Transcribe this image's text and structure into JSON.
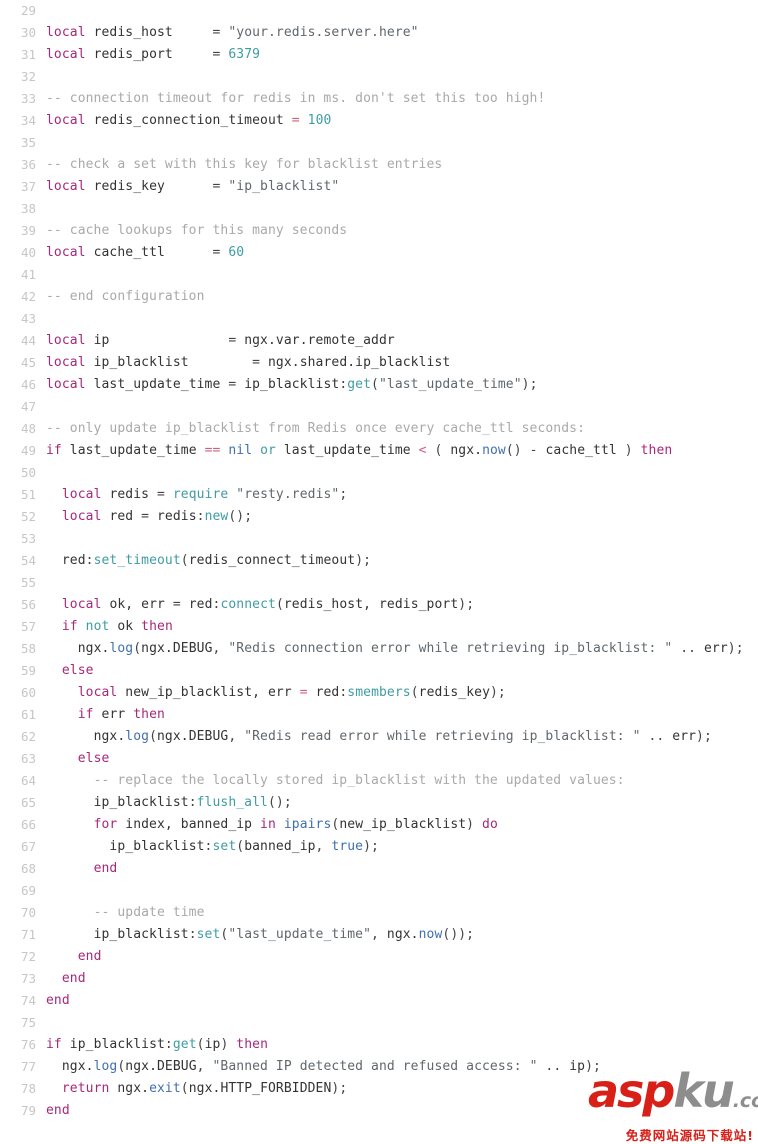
{
  "editor": {
    "language": "lua",
    "first_line_number": 29,
    "colors": {
      "background": "#ffffff",
      "gutter_text": "#c6c6c6",
      "default_text": "#333333",
      "keyword": "#a6287a",
      "number": "#3f9ca4",
      "string": "#60676d",
      "comment": "#a9a9a9",
      "function": "#3f9ca4",
      "builtin": "#4070b0",
      "operator": "#d0607a"
    }
  },
  "lines": [
    {
      "n": 29,
      "tokens": []
    },
    {
      "n": 30,
      "tokens": [
        {
          "t": "kw",
          "s": "local"
        },
        {
          "t": "pun",
          "s": " "
        },
        {
          "t": "id",
          "s": "redis_host"
        },
        {
          "t": "pun",
          "s": "     = "
        },
        {
          "t": "str",
          "s": "\"your.redis.server.here\""
        }
      ]
    },
    {
      "n": 31,
      "tokens": [
        {
          "t": "kw",
          "s": "local"
        },
        {
          "t": "pun",
          "s": " "
        },
        {
          "t": "id",
          "s": "redis_port"
        },
        {
          "t": "pun",
          "s": "     = "
        },
        {
          "t": "num",
          "s": "6379"
        }
      ]
    },
    {
      "n": 32,
      "tokens": []
    },
    {
      "n": 33,
      "tokens": [
        {
          "t": "com",
          "s": "-- connection timeout for redis in ms. don't set this too high!"
        }
      ]
    },
    {
      "n": 34,
      "tokens": [
        {
          "t": "kw",
          "s": "local"
        },
        {
          "t": "pun",
          "s": " "
        },
        {
          "t": "id",
          "s": "redis_connection_timeout"
        },
        {
          "t": "pun",
          "s": " "
        },
        {
          "t": "op",
          "s": "="
        },
        {
          "t": "pun",
          "s": " "
        },
        {
          "t": "num",
          "s": "100"
        }
      ]
    },
    {
      "n": 35,
      "tokens": []
    },
    {
      "n": 36,
      "tokens": [
        {
          "t": "com",
          "s": "-- check a set with this key for blacklist entries"
        }
      ]
    },
    {
      "n": 37,
      "tokens": [
        {
          "t": "kw",
          "s": "local"
        },
        {
          "t": "pun",
          "s": " "
        },
        {
          "t": "id",
          "s": "redis_key"
        },
        {
          "t": "pun",
          "s": "      = "
        },
        {
          "t": "str",
          "s": "\"ip_blacklist\""
        }
      ]
    },
    {
      "n": 38,
      "tokens": []
    },
    {
      "n": 39,
      "tokens": [
        {
          "t": "com",
          "s": "-- cache lookups for this many seconds"
        }
      ]
    },
    {
      "n": 40,
      "tokens": [
        {
          "t": "kw",
          "s": "local"
        },
        {
          "t": "pun",
          "s": " "
        },
        {
          "t": "id",
          "s": "cache_ttl"
        },
        {
          "t": "pun",
          "s": "      = "
        },
        {
          "t": "num",
          "s": "60"
        }
      ]
    },
    {
      "n": 41,
      "tokens": []
    },
    {
      "n": 42,
      "tokens": [
        {
          "t": "com",
          "s": "-- end configuration"
        }
      ]
    },
    {
      "n": 43,
      "tokens": []
    },
    {
      "n": 44,
      "tokens": [
        {
          "t": "kw",
          "s": "local"
        },
        {
          "t": "pun",
          "s": " "
        },
        {
          "t": "id",
          "s": "ip"
        },
        {
          "t": "pun",
          "s": "               = "
        },
        {
          "t": "id",
          "s": "ngx.var.remote_addr"
        }
      ]
    },
    {
      "n": 45,
      "tokens": [
        {
          "t": "kw",
          "s": "local"
        },
        {
          "t": "pun",
          "s": " "
        },
        {
          "t": "id",
          "s": "ip_blacklist"
        },
        {
          "t": "pun",
          "s": "        = "
        },
        {
          "t": "id",
          "s": "ngx.shared.ip_blacklist"
        }
      ]
    },
    {
      "n": 46,
      "tokens": [
        {
          "t": "kw",
          "s": "local"
        },
        {
          "t": "pun",
          "s": " "
        },
        {
          "t": "id",
          "s": "last_update_time"
        },
        {
          "t": "pun",
          "s": " = "
        },
        {
          "t": "id",
          "s": "ip_blacklist"
        },
        {
          "t": "pun",
          "s": ":"
        },
        {
          "t": "fn",
          "s": "get"
        },
        {
          "t": "pun",
          "s": "("
        },
        {
          "t": "str",
          "s": "\"last_update_time\""
        },
        {
          "t": "pun",
          "s": ");"
        }
      ]
    },
    {
      "n": 47,
      "tokens": []
    },
    {
      "n": 48,
      "tokens": [
        {
          "t": "com",
          "s": "-- only update ip_blacklist from Redis once every cache_ttl seconds:"
        }
      ]
    },
    {
      "n": 49,
      "tokens": [
        {
          "t": "kw",
          "s": "if"
        },
        {
          "t": "pun",
          "s": " "
        },
        {
          "t": "id",
          "s": "last_update_time"
        },
        {
          "t": "pun",
          "s": " "
        },
        {
          "t": "op",
          "s": "=="
        },
        {
          "t": "pun",
          "s": " "
        },
        {
          "t": "blt",
          "s": "nil"
        },
        {
          "t": "pun",
          "s": " "
        },
        {
          "t": "fn",
          "s": "or"
        },
        {
          "t": "pun",
          "s": " "
        },
        {
          "t": "id",
          "s": "last_update_time"
        },
        {
          "t": "pun",
          "s": " "
        },
        {
          "t": "op",
          "s": "<"
        },
        {
          "t": "pun",
          "s": " ( "
        },
        {
          "t": "id",
          "s": "ngx."
        },
        {
          "t": "blt",
          "s": "now"
        },
        {
          "t": "pun",
          "s": "() - "
        },
        {
          "t": "id",
          "s": "cache_ttl"
        },
        {
          "t": "pun",
          "s": " ) "
        },
        {
          "t": "kw",
          "s": "then"
        }
      ]
    },
    {
      "n": 50,
      "tokens": []
    },
    {
      "n": 51,
      "tokens": [
        {
          "t": "pun",
          "s": "  "
        },
        {
          "t": "kw",
          "s": "local"
        },
        {
          "t": "pun",
          "s": " "
        },
        {
          "t": "id",
          "s": "redis"
        },
        {
          "t": "pun",
          "s": " = "
        },
        {
          "t": "fn",
          "s": "require"
        },
        {
          "t": "pun",
          "s": " "
        },
        {
          "t": "str",
          "s": "\"resty.redis\""
        },
        {
          "t": "pun",
          "s": ";"
        }
      ]
    },
    {
      "n": 52,
      "tokens": [
        {
          "t": "pun",
          "s": "  "
        },
        {
          "t": "kw",
          "s": "local"
        },
        {
          "t": "pun",
          "s": " "
        },
        {
          "t": "id",
          "s": "red"
        },
        {
          "t": "pun",
          "s": " = "
        },
        {
          "t": "id",
          "s": "redis"
        },
        {
          "t": "pun",
          "s": ":"
        },
        {
          "t": "fn",
          "s": "new"
        },
        {
          "t": "pun",
          "s": "();"
        }
      ]
    },
    {
      "n": 53,
      "tokens": []
    },
    {
      "n": 54,
      "tokens": [
        {
          "t": "pun",
          "s": "  "
        },
        {
          "t": "id",
          "s": "red"
        },
        {
          "t": "pun",
          "s": ":"
        },
        {
          "t": "fn",
          "s": "set_timeout"
        },
        {
          "t": "pun",
          "s": "("
        },
        {
          "t": "id",
          "s": "redis_connect_timeout"
        },
        {
          "t": "pun",
          "s": ");"
        }
      ]
    },
    {
      "n": 55,
      "tokens": []
    },
    {
      "n": 56,
      "tokens": [
        {
          "t": "pun",
          "s": "  "
        },
        {
          "t": "kw",
          "s": "local"
        },
        {
          "t": "pun",
          "s": " "
        },
        {
          "t": "id",
          "s": "ok, err"
        },
        {
          "t": "pun",
          "s": " = "
        },
        {
          "t": "id",
          "s": "red"
        },
        {
          "t": "pun",
          "s": ":"
        },
        {
          "t": "fn",
          "s": "connect"
        },
        {
          "t": "pun",
          "s": "("
        },
        {
          "t": "id",
          "s": "redis_host, redis_port"
        },
        {
          "t": "pun",
          "s": ");"
        }
      ]
    },
    {
      "n": 57,
      "tokens": [
        {
          "t": "pun",
          "s": "  "
        },
        {
          "t": "kw",
          "s": "if"
        },
        {
          "t": "pun",
          "s": " "
        },
        {
          "t": "fn",
          "s": "not"
        },
        {
          "t": "pun",
          "s": " "
        },
        {
          "t": "id",
          "s": "ok"
        },
        {
          "t": "pun",
          "s": " "
        },
        {
          "t": "kw",
          "s": "then"
        }
      ]
    },
    {
      "n": 58,
      "tokens": [
        {
          "t": "pun",
          "s": "    "
        },
        {
          "t": "id",
          "s": "ngx."
        },
        {
          "t": "blt",
          "s": "log"
        },
        {
          "t": "pun",
          "s": "("
        },
        {
          "t": "id",
          "s": "ngx.DEBUG"
        },
        {
          "t": "pun",
          "s": ", "
        },
        {
          "t": "str",
          "s": "\"Redis connection error while retrieving ip_blacklist: \""
        },
        {
          "t": "pun",
          "s": " .. "
        },
        {
          "t": "id",
          "s": "err"
        },
        {
          "t": "pun",
          "s": ");"
        }
      ]
    },
    {
      "n": 59,
      "tokens": [
        {
          "t": "pun",
          "s": "  "
        },
        {
          "t": "kw",
          "s": "else"
        }
      ]
    },
    {
      "n": 60,
      "tokens": [
        {
          "t": "pun",
          "s": "    "
        },
        {
          "t": "kw",
          "s": "local"
        },
        {
          "t": "pun",
          "s": " "
        },
        {
          "t": "id",
          "s": "new_ip_blacklist, err"
        },
        {
          "t": "pun",
          "s": " "
        },
        {
          "t": "op",
          "s": "="
        },
        {
          "t": "pun",
          "s": " "
        },
        {
          "t": "id",
          "s": "red"
        },
        {
          "t": "pun",
          "s": ":"
        },
        {
          "t": "fn",
          "s": "smembers"
        },
        {
          "t": "pun",
          "s": "("
        },
        {
          "t": "id",
          "s": "redis_key"
        },
        {
          "t": "pun",
          "s": ");"
        }
      ]
    },
    {
      "n": 61,
      "tokens": [
        {
          "t": "pun",
          "s": "    "
        },
        {
          "t": "kw",
          "s": "if"
        },
        {
          "t": "pun",
          "s": " "
        },
        {
          "t": "id",
          "s": "err"
        },
        {
          "t": "pun",
          "s": " "
        },
        {
          "t": "kw",
          "s": "then"
        }
      ]
    },
    {
      "n": 62,
      "tokens": [
        {
          "t": "pun",
          "s": "      "
        },
        {
          "t": "id",
          "s": "ngx."
        },
        {
          "t": "blt",
          "s": "log"
        },
        {
          "t": "pun",
          "s": "("
        },
        {
          "t": "id",
          "s": "ngx.DEBUG"
        },
        {
          "t": "pun",
          "s": ", "
        },
        {
          "t": "str",
          "s": "\"Redis read error while retrieving ip_blacklist: \""
        },
        {
          "t": "pun",
          "s": " .. "
        },
        {
          "t": "id",
          "s": "err"
        },
        {
          "t": "pun",
          "s": ");"
        }
      ]
    },
    {
      "n": 63,
      "tokens": [
        {
          "t": "pun",
          "s": "    "
        },
        {
          "t": "kw",
          "s": "else"
        }
      ]
    },
    {
      "n": 64,
      "tokens": [
        {
          "t": "pun",
          "s": "      "
        },
        {
          "t": "com",
          "s": "-- replace the locally stored ip_blacklist with the updated values:"
        }
      ]
    },
    {
      "n": 65,
      "tokens": [
        {
          "t": "pun",
          "s": "      "
        },
        {
          "t": "id",
          "s": "ip_blacklist"
        },
        {
          "t": "pun",
          "s": ":"
        },
        {
          "t": "fn",
          "s": "flush_all"
        },
        {
          "t": "pun",
          "s": "();"
        }
      ]
    },
    {
      "n": 66,
      "tokens": [
        {
          "t": "pun",
          "s": "      "
        },
        {
          "t": "kw",
          "s": "for"
        },
        {
          "t": "pun",
          "s": " "
        },
        {
          "t": "id",
          "s": "index, banned_ip"
        },
        {
          "t": "pun",
          "s": " "
        },
        {
          "t": "kw",
          "s": "in"
        },
        {
          "t": "pun",
          "s": " "
        },
        {
          "t": "blt",
          "s": "ipairs"
        },
        {
          "t": "pun",
          "s": "("
        },
        {
          "t": "id",
          "s": "new_ip_blacklist"
        },
        {
          "t": "pun",
          "s": ") "
        },
        {
          "t": "kw",
          "s": "do"
        }
      ]
    },
    {
      "n": 67,
      "tokens": [
        {
          "t": "pun",
          "s": "        "
        },
        {
          "t": "id",
          "s": "ip_blacklist"
        },
        {
          "t": "pun",
          "s": ":"
        },
        {
          "t": "fn",
          "s": "set"
        },
        {
          "t": "pun",
          "s": "("
        },
        {
          "t": "id",
          "s": "banned_ip"
        },
        {
          "t": "pun",
          "s": ", "
        },
        {
          "t": "blt",
          "s": "true"
        },
        {
          "t": "pun",
          "s": ");"
        }
      ]
    },
    {
      "n": 68,
      "tokens": [
        {
          "t": "pun",
          "s": "      "
        },
        {
          "t": "kw",
          "s": "end"
        }
      ]
    },
    {
      "n": 69,
      "tokens": []
    },
    {
      "n": 70,
      "tokens": [
        {
          "t": "pun",
          "s": "      "
        },
        {
          "t": "com",
          "s": "-- update time"
        }
      ]
    },
    {
      "n": 71,
      "tokens": [
        {
          "t": "pun",
          "s": "      "
        },
        {
          "t": "id",
          "s": "ip_blacklist"
        },
        {
          "t": "pun",
          "s": ":"
        },
        {
          "t": "fn",
          "s": "set"
        },
        {
          "t": "pun",
          "s": "("
        },
        {
          "t": "str",
          "s": "\"last_update_time\""
        },
        {
          "t": "pun",
          "s": ", "
        },
        {
          "t": "id",
          "s": "ngx."
        },
        {
          "t": "blt",
          "s": "now"
        },
        {
          "t": "pun",
          "s": "());"
        }
      ]
    },
    {
      "n": 72,
      "tokens": [
        {
          "t": "pun",
          "s": "    "
        },
        {
          "t": "kw",
          "s": "end"
        }
      ]
    },
    {
      "n": 73,
      "tokens": [
        {
          "t": "pun",
          "s": "  "
        },
        {
          "t": "kw",
          "s": "end"
        }
      ]
    },
    {
      "n": 74,
      "tokens": [
        {
          "t": "kw",
          "s": "end"
        }
      ]
    },
    {
      "n": 75,
      "tokens": []
    },
    {
      "n": 76,
      "tokens": [
        {
          "t": "kw",
          "s": "if"
        },
        {
          "t": "pun",
          "s": " "
        },
        {
          "t": "id",
          "s": "ip_blacklist"
        },
        {
          "t": "pun",
          "s": ":"
        },
        {
          "t": "fn",
          "s": "get"
        },
        {
          "t": "pun",
          "s": "("
        },
        {
          "t": "id",
          "s": "ip"
        },
        {
          "t": "pun",
          "s": ") "
        },
        {
          "t": "kw",
          "s": "then"
        }
      ]
    },
    {
      "n": 77,
      "tokens": [
        {
          "t": "pun",
          "s": "  "
        },
        {
          "t": "id",
          "s": "ngx."
        },
        {
          "t": "blt",
          "s": "log"
        },
        {
          "t": "pun",
          "s": "("
        },
        {
          "t": "id",
          "s": "ngx.DEBUG"
        },
        {
          "t": "pun",
          "s": ", "
        },
        {
          "t": "str",
          "s": "\"Banned IP detected and refused access: \""
        },
        {
          "t": "pun",
          "s": " .. "
        },
        {
          "t": "id",
          "s": "ip"
        },
        {
          "t": "pun",
          "s": ");"
        }
      ]
    },
    {
      "n": 78,
      "tokens": [
        {
          "t": "pun",
          "s": "  "
        },
        {
          "t": "kw",
          "s": "return"
        },
        {
          "t": "pun",
          "s": " "
        },
        {
          "t": "id",
          "s": "ngx."
        },
        {
          "t": "blt",
          "s": "exit"
        },
        {
          "t": "pun",
          "s": "("
        },
        {
          "t": "id",
          "s": "ngx.HTTP_FORBIDDEN"
        },
        {
          "t": "pun",
          "s": ");"
        }
      ]
    },
    {
      "n": 79,
      "tokens": [
        {
          "t": "kw",
          "s": "end"
        }
      ]
    }
  ],
  "watermark": {
    "brand_primary": "asp",
    "brand_secondary": "ku",
    "brand_tld": ".com",
    "tagline": "免费网站源码下载站!",
    "color_primary": "#d81f18",
    "color_secondary": "#8d8d8d"
  }
}
